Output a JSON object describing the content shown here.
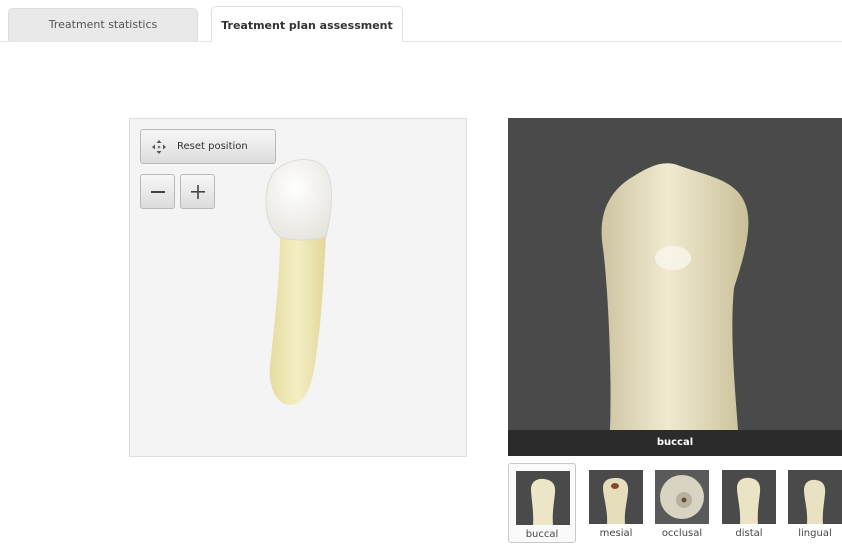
{
  "tabs": [
    {
      "label": "Treatment statistics",
      "active": false
    },
    {
      "label": "Treatment plan assessment",
      "active": true
    }
  ],
  "viewer": {
    "reset_label": "Reset position",
    "zoom_out_icon": "minus-icon",
    "zoom_in_icon": "plus-icon",
    "move_icon": "move-arrows-icon"
  },
  "photo": {
    "caption": "buccal"
  },
  "thumbnails": [
    {
      "label": "buccal",
      "selected": true
    },
    {
      "label": "mesial",
      "selected": false
    },
    {
      "label": "occlusal",
      "selected": false
    },
    {
      "label": "distal",
      "selected": false
    },
    {
      "label": "lingual",
      "selected": false
    }
  ],
  "colors": {
    "crown": "#f3f1ec",
    "root": "#efe8b6",
    "photo_background": "#4a4a4a"
  }
}
